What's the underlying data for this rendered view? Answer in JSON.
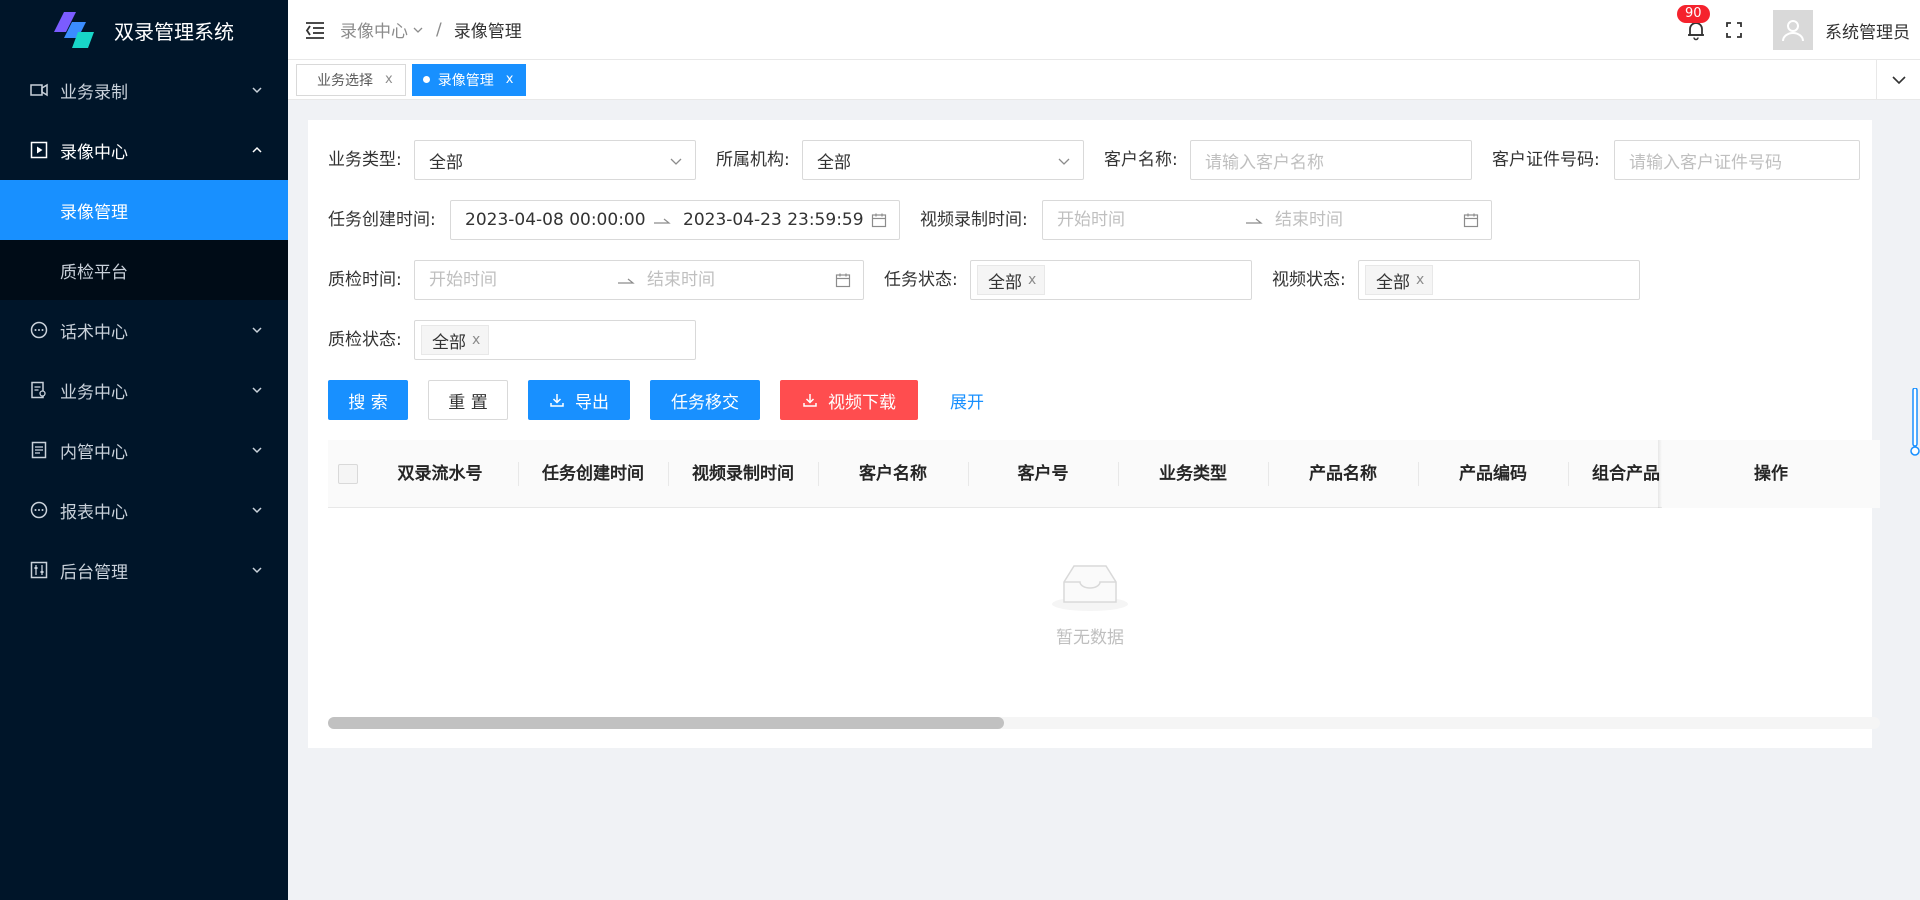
{
  "app": {
    "title": "双录管理系统"
  },
  "sidebar": {
    "items": [
      {
        "label": "业务录制",
        "icon": "video-icon"
      },
      {
        "label": "录像中心",
        "icon": "play-square-icon",
        "open": true,
        "children": [
          {
            "label": "录像管理",
            "active": true
          },
          {
            "label": "质检平台"
          }
        ]
      },
      {
        "label": "话术中心",
        "icon": "message-icon"
      },
      {
        "label": "业务中心",
        "icon": "audit-icon"
      },
      {
        "label": "内管中心",
        "icon": "file-icon"
      },
      {
        "label": "报表中心",
        "icon": "message-icon"
      },
      {
        "label": "后台管理",
        "icon": "sliders-icon"
      }
    ]
  },
  "header": {
    "breadcrumb": {
      "parent": "录像中心",
      "separator": "/",
      "current": "录像管理"
    },
    "notification_count": "90",
    "username": "系统管理员"
  },
  "tabs": [
    {
      "label": "业务选择",
      "close": "x",
      "active": false
    },
    {
      "label": "录像管理",
      "close": "x",
      "active": true
    }
  ],
  "filters": {
    "business_type": {
      "label": "业务类型:",
      "value": "全部"
    },
    "institution": {
      "label": "所属机构:",
      "value": "全部"
    },
    "customer_name": {
      "label": "客户名称:",
      "placeholder": "请输入客户名称"
    },
    "customer_id_number": {
      "label": "客户证件号码:",
      "placeholder": "请输入客户证件号码"
    },
    "task_created_time": {
      "label": "任务创建时间:",
      "start": "2023-04-08 00:00:00",
      "end": "2023-04-23 23:59:59"
    },
    "video_record_time": {
      "label": "视频录制时间:",
      "start_placeholder": "开始时间",
      "end_placeholder": "结束时间"
    },
    "qc_time": {
      "label": "质检时间:",
      "start_placeholder": "开始时间",
      "end_placeholder": "结束时间"
    },
    "task_status": {
      "label": "任务状态:",
      "tag": "全部"
    },
    "video_status": {
      "label": "视频状态:",
      "tag": "全部"
    },
    "qc_status": {
      "label": "质检状态:",
      "tag": "全部"
    }
  },
  "buttons": {
    "search": "搜 索",
    "reset": "重 置",
    "export": "导出",
    "transfer": "任务移交",
    "video_download": "视频下载",
    "expand": "展开"
  },
  "table": {
    "columns": [
      "双录流水号",
      "任务创建时间",
      "视频录制时间",
      "客户名称",
      "客户号",
      "业务类型",
      "产品名称",
      "产品编码",
      "组合产品",
      "操作"
    ],
    "empty_text": "暂无数据"
  },
  "colors": {
    "primary": "#1890ff",
    "danger": "#ff4d4f",
    "sidebar_bg": "#001529"
  }
}
